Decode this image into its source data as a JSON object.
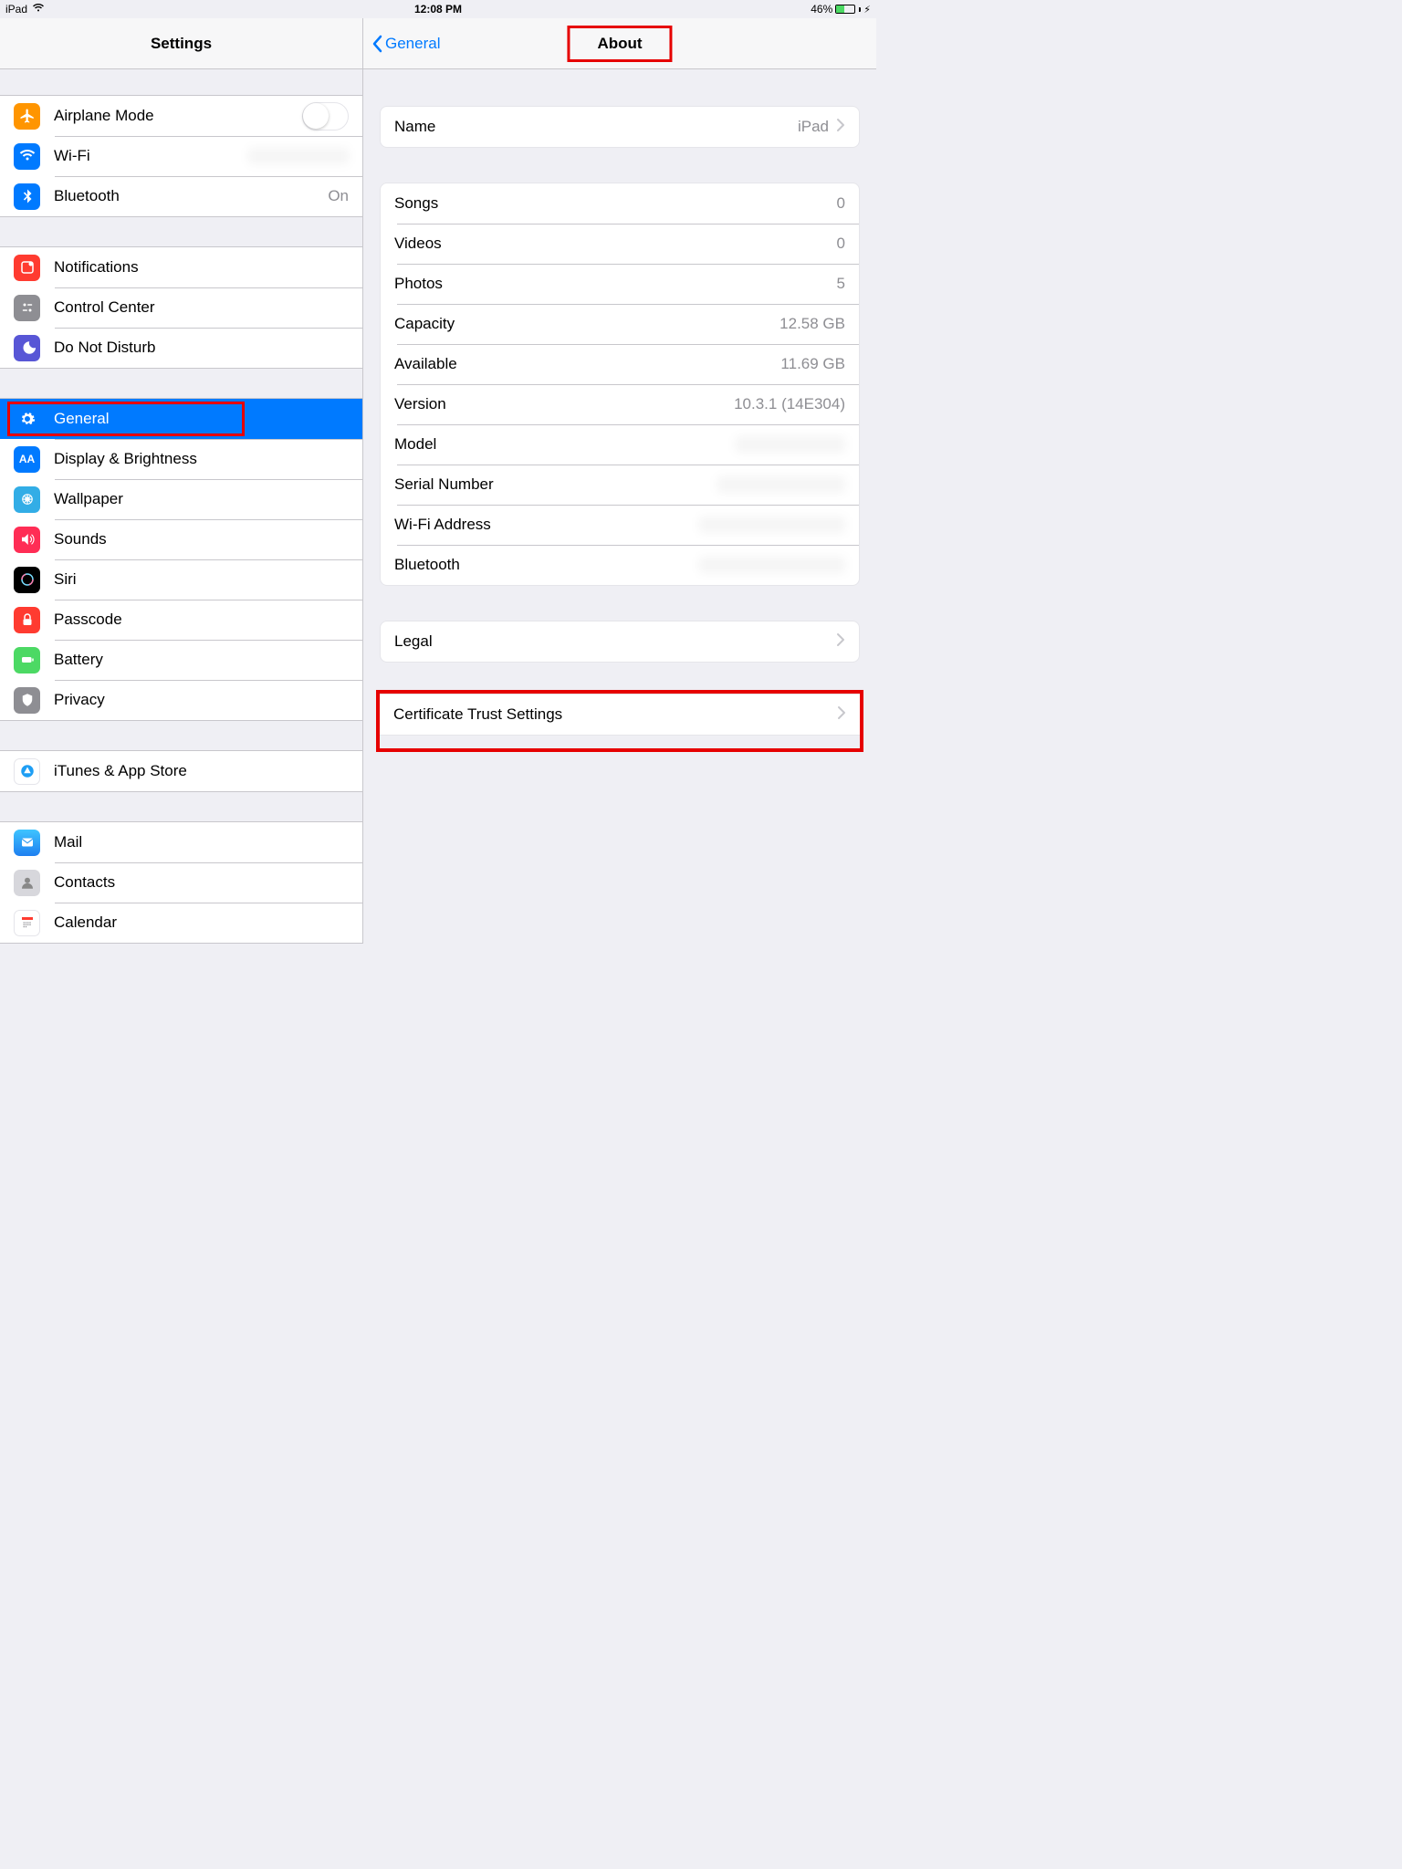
{
  "status": {
    "device": "iPad",
    "time": "12:08 PM",
    "battery_pct": "46%"
  },
  "sidebar": {
    "title": "Settings",
    "g1": {
      "airplane": "Airplane Mode",
      "wifi": "Wi-Fi",
      "wifi_value": "",
      "bluetooth": "Bluetooth",
      "bluetooth_value": "On"
    },
    "g2": {
      "notifications": "Notifications",
      "control_center": "Control Center",
      "dnd": "Do Not Disturb"
    },
    "g3": {
      "general": "General",
      "display": "Display & Brightness",
      "wallpaper": "Wallpaper",
      "sounds": "Sounds",
      "siri": "Siri",
      "passcode": "Passcode",
      "battery": "Battery",
      "privacy": "Privacy"
    },
    "g4": {
      "itunes": "iTunes & App Store"
    },
    "g5": {
      "mail": "Mail",
      "contacts": "Contacts",
      "calendar": "Calendar"
    }
  },
  "detail": {
    "back": "General",
    "title": "About",
    "name": {
      "label": "Name",
      "value": "iPad"
    },
    "stats": {
      "songs": {
        "label": "Songs",
        "value": "0"
      },
      "videos": {
        "label": "Videos",
        "value": "0"
      },
      "photos": {
        "label": "Photos",
        "value": "5"
      },
      "capacity": {
        "label": "Capacity",
        "value": "12.58 GB"
      },
      "available": {
        "label": "Available",
        "value": "11.69 GB"
      },
      "version": {
        "label": "Version",
        "value": "10.3.1 (14E304)"
      },
      "model": {
        "label": "Model",
        "value": ""
      },
      "serial": {
        "label": "Serial Number",
        "value": ""
      },
      "wifi_addr": {
        "label": "Wi-Fi Address",
        "value": ""
      },
      "bt_addr": {
        "label": "Bluetooth",
        "value": ""
      }
    },
    "legal": "Legal",
    "cert": "Certificate Trust Settings"
  }
}
